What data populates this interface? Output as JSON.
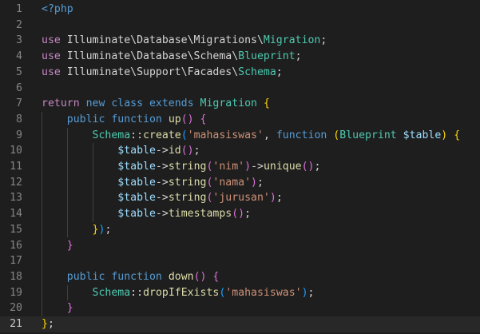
{
  "editor": {
    "current_line": 21,
    "colors": {
      "background": "#1e1e1e",
      "current_line_bg": "#282828",
      "line_number": "#858585",
      "keyword": "#c586c0",
      "storage": "#569cd6",
      "class": "#4ec9b0",
      "function": "#dcdcaa",
      "variable": "#9cdcfe",
      "string": "#ce9178",
      "text": "#d4d4d4",
      "bracket_yellow": "#ffd700",
      "bracket_pink": "#da70d6",
      "bracket_blue": "#179fff"
    },
    "lines": [
      {
        "num": "1",
        "tokens": [
          {
            "t": "<?php",
            "c": "#569cd6"
          }
        ]
      },
      {
        "num": "2",
        "tokens": []
      },
      {
        "num": "3",
        "tokens": [
          {
            "t": "use ",
            "c": "#c586c0"
          },
          {
            "t": "Illuminate\\Database\\Migrations\\",
            "c": "#d4d4d4"
          },
          {
            "t": "Migration",
            "c": "#4ec9b0"
          },
          {
            "t": ";",
            "c": "#d4d4d4"
          }
        ]
      },
      {
        "num": "4",
        "tokens": [
          {
            "t": "use ",
            "c": "#c586c0"
          },
          {
            "t": "Illuminate\\Database\\Schema\\",
            "c": "#d4d4d4"
          },
          {
            "t": "Blueprint",
            "c": "#4ec9b0"
          },
          {
            "t": ";",
            "c": "#d4d4d4"
          }
        ]
      },
      {
        "num": "5",
        "tokens": [
          {
            "t": "use ",
            "c": "#c586c0"
          },
          {
            "t": "Illuminate\\Support\\Facades\\",
            "c": "#d4d4d4"
          },
          {
            "t": "Schema",
            "c": "#4ec9b0"
          },
          {
            "t": ";",
            "c": "#d4d4d4"
          }
        ]
      },
      {
        "num": "6",
        "tokens": []
      },
      {
        "num": "7",
        "tokens": [
          {
            "t": "return ",
            "c": "#c586c0"
          },
          {
            "t": "new ",
            "c": "#569cd6"
          },
          {
            "t": "class ",
            "c": "#569cd6"
          },
          {
            "t": "extends ",
            "c": "#569cd6"
          },
          {
            "t": "Migration",
            "c": "#4ec9b0"
          },
          {
            "t": " ",
            "c": "#d4d4d4"
          },
          {
            "t": "{",
            "c": "#ffd700"
          }
        ]
      },
      {
        "num": "8",
        "tokens": [
          {
            "t": "    ",
            "c": "#d4d4d4"
          },
          {
            "t": "public ",
            "c": "#569cd6"
          },
          {
            "t": "function ",
            "c": "#569cd6"
          },
          {
            "t": "up",
            "c": "#dcdcaa"
          },
          {
            "t": "() ",
            "c": "#da70d6"
          },
          {
            "t": "{",
            "c": "#da70d6"
          }
        ]
      },
      {
        "num": "9",
        "tokens": [
          {
            "t": "        ",
            "c": "#d4d4d4"
          },
          {
            "t": "Schema",
            "c": "#4ec9b0"
          },
          {
            "t": "::",
            "c": "#d4d4d4"
          },
          {
            "t": "create",
            "c": "#dcdcaa"
          },
          {
            "t": "(",
            "c": "#179fff"
          },
          {
            "t": "'mahasiswas'",
            "c": "#ce9178"
          },
          {
            "t": ", ",
            "c": "#d4d4d4"
          },
          {
            "t": "function ",
            "c": "#569cd6"
          },
          {
            "t": "(",
            "c": "#ffd700"
          },
          {
            "t": "Blueprint",
            "c": "#4ec9b0"
          },
          {
            "t": " $table",
            "c": "#9cdcfe"
          },
          {
            "t": ")",
            "c": "#ffd700"
          },
          {
            "t": " ",
            "c": "#d4d4d4"
          },
          {
            "t": "{",
            "c": "#ffd700"
          }
        ]
      },
      {
        "num": "10",
        "tokens": [
          {
            "t": "            ",
            "c": "#d4d4d4"
          },
          {
            "t": "$table",
            "c": "#9cdcfe"
          },
          {
            "t": "->",
            "c": "#d4d4d4"
          },
          {
            "t": "id",
            "c": "#dcdcaa"
          },
          {
            "t": "()",
            "c": "#da70d6"
          },
          {
            "t": ";",
            "c": "#d4d4d4"
          }
        ]
      },
      {
        "num": "11",
        "tokens": [
          {
            "t": "            ",
            "c": "#d4d4d4"
          },
          {
            "t": "$table",
            "c": "#9cdcfe"
          },
          {
            "t": "->",
            "c": "#d4d4d4"
          },
          {
            "t": "string",
            "c": "#dcdcaa"
          },
          {
            "t": "(",
            "c": "#da70d6"
          },
          {
            "t": "'nim'",
            "c": "#ce9178"
          },
          {
            "t": ")",
            "c": "#da70d6"
          },
          {
            "t": "->",
            "c": "#d4d4d4"
          },
          {
            "t": "unique",
            "c": "#dcdcaa"
          },
          {
            "t": "()",
            "c": "#da70d6"
          },
          {
            "t": ";",
            "c": "#d4d4d4"
          }
        ]
      },
      {
        "num": "12",
        "tokens": [
          {
            "t": "            ",
            "c": "#d4d4d4"
          },
          {
            "t": "$table",
            "c": "#9cdcfe"
          },
          {
            "t": "->",
            "c": "#d4d4d4"
          },
          {
            "t": "string",
            "c": "#dcdcaa"
          },
          {
            "t": "(",
            "c": "#da70d6"
          },
          {
            "t": "'nama'",
            "c": "#ce9178"
          },
          {
            "t": ")",
            "c": "#da70d6"
          },
          {
            "t": ";",
            "c": "#d4d4d4"
          }
        ]
      },
      {
        "num": "13",
        "tokens": [
          {
            "t": "            ",
            "c": "#d4d4d4"
          },
          {
            "t": "$table",
            "c": "#9cdcfe"
          },
          {
            "t": "->",
            "c": "#d4d4d4"
          },
          {
            "t": "string",
            "c": "#dcdcaa"
          },
          {
            "t": "(",
            "c": "#da70d6"
          },
          {
            "t": "'jurusan'",
            "c": "#ce9178"
          },
          {
            "t": ")",
            "c": "#da70d6"
          },
          {
            "t": ";",
            "c": "#d4d4d4"
          }
        ]
      },
      {
        "num": "14",
        "tokens": [
          {
            "t": "            ",
            "c": "#d4d4d4"
          },
          {
            "t": "$table",
            "c": "#9cdcfe"
          },
          {
            "t": "->",
            "c": "#d4d4d4"
          },
          {
            "t": "timestamps",
            "c": "#dcdcaa"
          },
          {
            "t": "()",
            "c": "#da70d6"
          },
          {
            "t": ";",
            "c": "#d4d4d4"
          }
        ]
      },
      {
        "num": "15",
        "tokens": [
          {
            "t": "        ",
            "c": "#d4d4d4"
          },
          {
            "t": "}",
            "c": "#ffd700"
          },
          {
            "t": ")",
            "c": "#179fff"
          },
          {
            "t": ";",
            "c": "#d4d4d4"
          }
        ]
      },
      {
        "num": "16",
        "tokens": [
          {
            "t": "    ",
            "c": "#d4d4d4"
          },
          {
            "t": "}",
            "c": "#da70d6"
          }
        ]
      },
      {
        "num": "17",
        "tokens": []
      },
      {
        "num": "18",
        "tokens": [
          {
            "t": "    ",
            "c": "#d4d4d4"
          },
          {
            "t": "public ",
            "c": "#569cd6"
          },
          {
            "t": "function ",
            "c": "#569cd6"
          },
          {
            "t": "down",
            "c": "#dcdcaa"
          },
          {
            "t": "() ",
            "c": "#da70d6"
          },
          {
            "t": "{",
            "c": "#da70d6"
          }
        ]
      },
      {
        "num": "19",
        "tokens": [
          {
            "t": "        ",
            "c": "#d4d4d4"
          },
          {
            "t": "Schema",
            "c": "#4ec9b0"
          },
          {
            "t": "::",
            "c": "#d4d4d4"
          },
          {
            "t": "dropIfExists",
            "c": "#dcdcaa"
          },
          {
            "t": "(",
            "c": "#179fff"
          },
          {
            "t": "'mahasiswas'",
            "c": "#ce9178"
          },
          {
            "t": ")",
            "c": "#179fff"
          },
          {
            "t": ";",
            "c": "#d4d4d4"
          }
        ]
      },
      {
        "num": "20",
        "tokens": [
          {
            "t": "    ",
            "c": "#d4d4d4"
          },
          {
            "t": "}",
            "c": "#da70d6"
          }
        ]
      },
      {
        "num": "21",
        "tokens": [
          {
            "t": "}",
            "c": "#ffd700"
          },
          {
            "t": ";",
            "c": "#d4d4d4"
          }
        ]
      }
    ]
  }
}
